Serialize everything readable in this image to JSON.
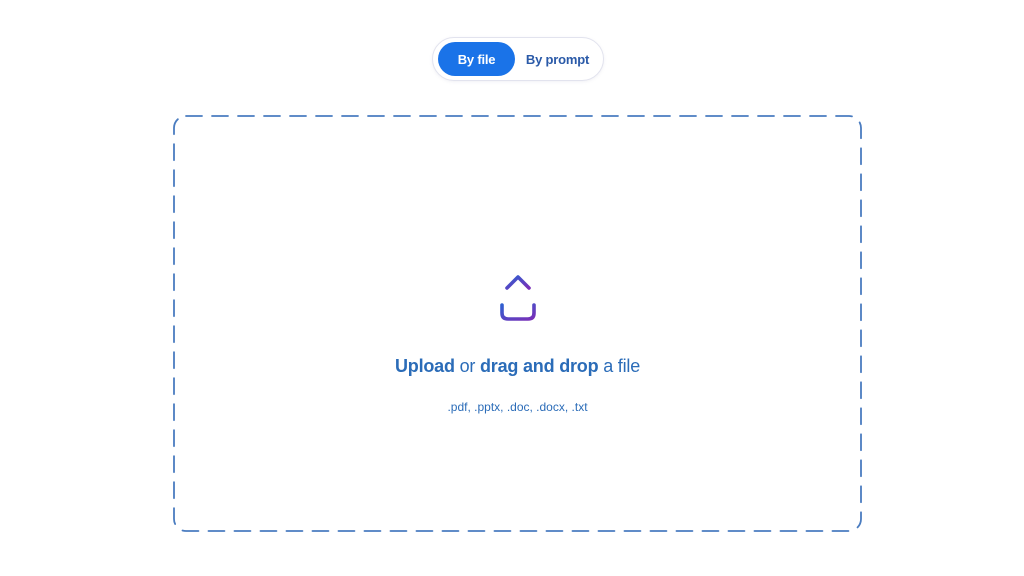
{
  "mode_toggle": {
    "options": [
      {
        "label": "By file",
        "active": true
      },
      {
        "label": "By prompt",
        "active": false
      }
    ]
  },
  "dropzone": {
    "icon": "upload-icon",
    "title_parts": {
      "upload": "Upload",
      "or": " or ",
      "drag_drop": "drag and drop",
      "a_file": " a file"
    },
    "accepted_formats": ".pdf, .pptx, .doc, .docx, .txt"
  },
  "colors": {
    "accent": "#1a73e8",
    "text_blue": "#2b6cb8",
    "border_dash": "#4a7cc0",
    "icon_gradient_start": "#2f5fd0",
    "icon_gradient_end": "#7a2fb8"
  }
}
